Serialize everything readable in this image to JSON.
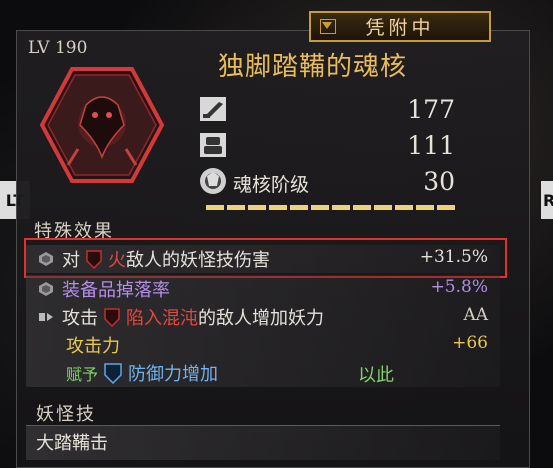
{
  "status": {
    "label": "凭附中"
  },
  "item": {
    "level": "LV 190",
    "name": "独脚踏鞴的魂核"
  },
  "stats": {
    "attack": "177",
    "defense": "111",
    "rank_label": "魂核阶级",
    "rank_value": "30",
    "rank_segments": 12
  },
  "nav": {
    "left": "LT",
    "right": "R"
  },
  "special": {
    "heading": "特殊效果",
    "effects": [
      {
        "lead": "对",
        "element": "火",
        "text": "敌人的妖怪技伤害",
        "value": "+31.5%"
      },
      {
        "lead": "",
        "element": "",
        "text": "装备品掉落率",
        "value": "+5.8%"
      },
      {
        "lead": "攻击",
        "element": "陷入混沌",
        "text": "的敌人增加妖力",
        "value": "AA"
      },
      {
        "lead": "",
        "element": "",
        "text": "攻击力",
        "value": "+66"
      },
      {
        "lead": "赋予",
        "element": "",
        "text": "防御力增加",
        "value": "以此"
      }
    ]
  },
  "yokai_skill": {
    "heading": "妖怪技",
    "name": "大踏鞴击"
  },
  "colors": {
    "gold": "#e9bd58",
    "purple": "#b48ee8",
    "red": "#e5473f",
    "blue": "#6fb3f0",
    "green": "#7fd36a",
    "highlight_border": "#e0312a"
  }
}
